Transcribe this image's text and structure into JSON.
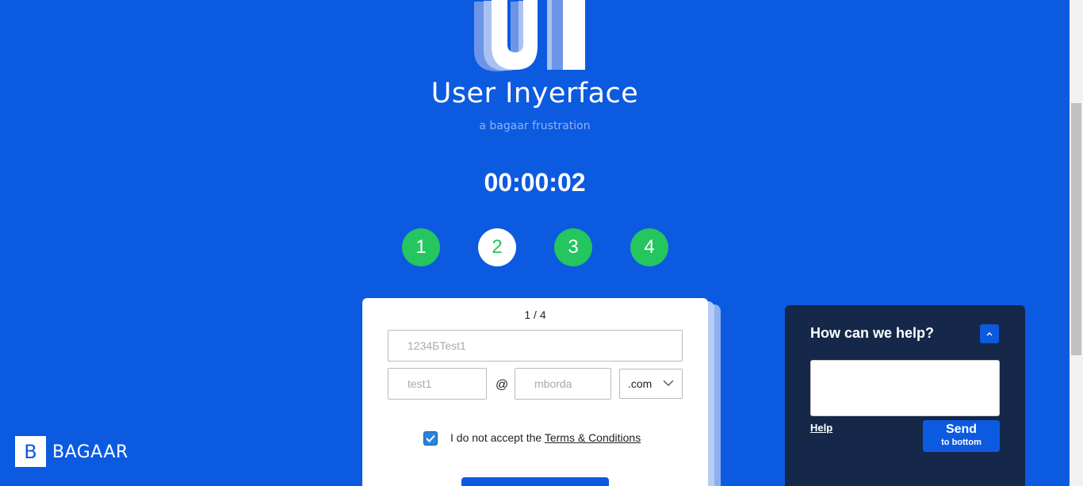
{
  "header": {
    "title": "User Inyerface",
    "subtitle": "a bagaar frustration",
    "timer": "00:00:02"
  },
  "steps": [
    {
      "label": "1",
      "state": "complete"
    },
    {
      "label": "2",
      "state": "active"
    },
    {
      "label": "3",
      "state": "complete"
    },
    {
      "label": "4",
      "state": "complete"
    }
  ],
  "form": {
    "page_count": "1 / 4",
    "password_value": "1234БTest1",
    "email_name_value": "test1",
    "at_sign": "@",
    "email_domain_value": "mborda",
    "tld_selected": ".com",
    "terms_prefix": "I do not accept the ",
    "terms_link": "Terms & Conditions",
    "terms_checked": true
  },
  "help": {
    "title": "How can we help?",
    "link": "Help",
    "send_label": "Send",
    "send_sublabel": "to bottom"
  },
  "brand": {
    "initial": "B",
    "name": "BAGAAR"
  },
  "colors": {
    "background": "#0c5ae0",
    "step_green": "#25c55f",
    "help_panel": "#15284a"
  }
}
